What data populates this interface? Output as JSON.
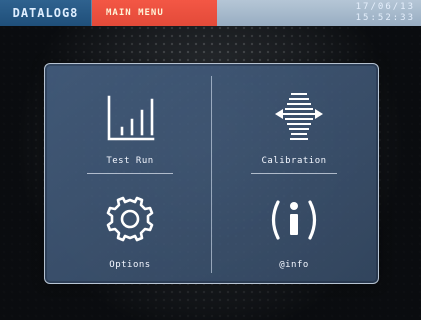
{
  "topbar": {
    "brand": "DATALOG8",
    "title": "MAIN MENU",
    "clock_line1": "17/06/13",
    "clock_line2": "15:52:33"
  },
  "menu": {
    "items": [
      {
        "label": "Test Run",
        "icon": "bar-chart-icon"
      },
      {
        "label": "Calibration",
        "icon": "calibration-icon"
      },
      {
        "label": "Options",
        "icon": "gear-icon"
      },
      {
        "label": "@info",
        "icon": "info-icon"
      }
    ]
  },
  "colors": {
    "brand_bg": "#2f628f",
    "title_bg": "#e34a39",
    "panel_bg": "#435c7c",
    "text": "#f3f7ff"
  }
}
